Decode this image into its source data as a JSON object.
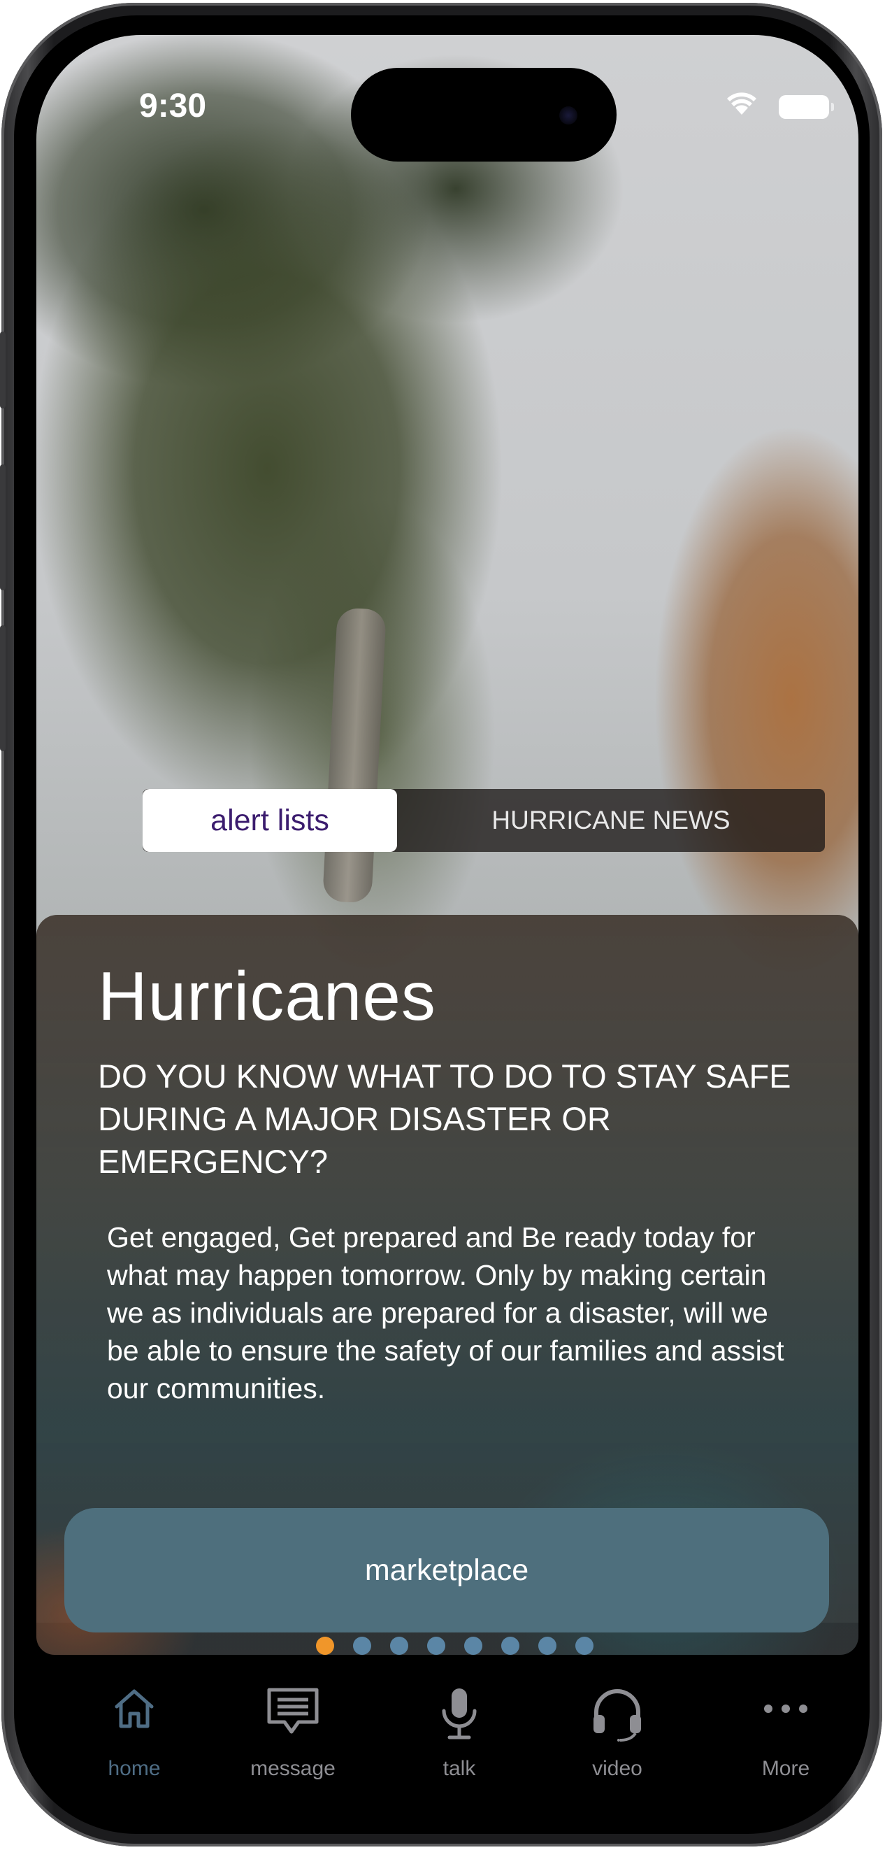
{
  "status_bar": {
    "time": "9:30"
  },
  "segmented_tabs": {
    "active": "alert lists",
    "inactive": "HURRICANE NEWS"
  },
  "card": {
    "title": "Hurricanes",
    "subtitle": "DO YOU KNOW WHAT TO DO TO STAY SAFE DURING A MAJOR DISASTER OR EMERGENCY?",
    "body": "Get engaged, Get prepared and Be ready today for what may happen tomorrow. Only by making certain we as individuals are prepared for a disaster, will we be able to ensure the safety of our families and assist our communities.",
    "button_label": "marketplace"
  },
  "pager": {
    "count": 8,
    "active_index": 0,
    "active_color": "#f0962a",
    "inactive_color": "#5b86a6"
  },
  "tab_bar": {
    "items": [
      {
        "label": "home",
        "icon": "home-icon",
        "active": true
      },
      {
        "label": "message",
        "icon": "message-icon",
        "active": false
      },
      {
        "label": "talk",
        "icon": "microphone-icon",
        "active": false
      },
      {
        "label": "video",
        "icon": "headphones-icon",
        "active": false
      },
      {
        "label": "More",
        "icon": "more-icon",
        "active": false
      }
    ],
    "active_color": "#4f6d85",
    "inactive_color": "#8e8e93"
  }
}
